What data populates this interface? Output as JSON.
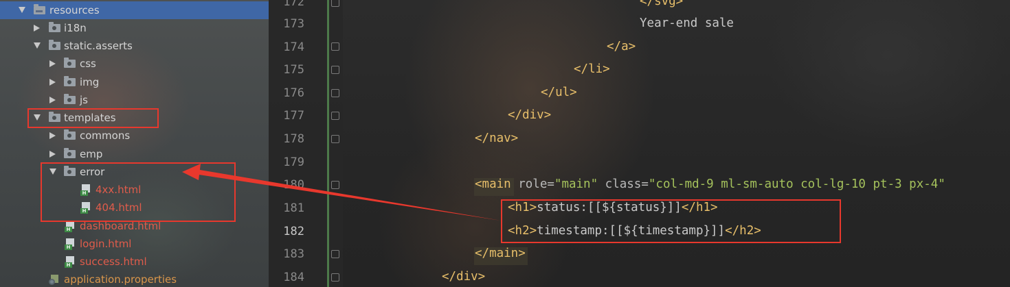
{
  "tree": {
    "items": [
      {
        "label": "resources",
        "level": 0,
        "kind": "res-folder",
        "state": "open",
        "selected": true
      },
      {
        "label": "i18n",
        "level": 1,
        "kind": "folder",
        "state": "closed"
      },
      {
        "label": "static.asserts",
        "level": 1,
        "kind": "folder",
        "state": "open"
      },
      {
        "label": "css",
        "level": 2,
        "kind": "folder",
        "state": "closed"
      },
      {
        "label": "img",
        "level": 2,
        "kind": "folder",
        "state": "closed"
      },
      {
        "label": "js",
        "level": 2,
        "kind": "folder",
        "state": "closed"
      },
      {
        "label": "templates",
        "level": 1,
        "kind": "folder",
        "state": "open"
      },
      {
        "label": "commons",
        "level": 2,
        "kind": "folder",
        "state": "closed"
      },
      {
        "label": "emp",
        "level": 2,
        "kind": "folder",
        "state": "closed"
      },
      {
        "label": "error",
        "level": 2,
        "kind": "folder",
        "state": "open"
      },
      {
        "label": "4xx.html",
        "level": 3,
        "kind": "html"
      },
      {
        "label": "404.html",
        "level": 3,
        "kind": "html"
      },
      {
        "label": "dashboard.html",
        "level": 2,
        "kind": "html"
      },
      {
        "label": "login.html",
        "level": 2,
        "kind": "html"
      },
      {
        "label": "success.html",
        "level": 2,
        "kind": "html"
      },
      {
        "label": "application.properties",
        "level": 1,
        "kind": "properties"
      }
    ]
  },
  "editor": {
    "current_line": 182,
    "lines": [
      {
        "num": "172",
        "text": "</svg>"
      },
      {
        "num": "173",
        "text": "Year-end sale"
      },
      {
        "num": "174",
        "text": "</a>"
      },
      {
        "num": "175",
        "text": "</li>"
      },
      {
        "num": "176",
        "text": "</ul>"
      },
      {
        "num": "177",
        "text": "</div>"
      },
      {
        "num": "178",
        "text": "</nav>"
      },
      {
        "num": "179",
        "text": ""
      },
      {
        "num": "180",
        "tag_open": "<main",
        "attr1": " role=",
        "val1": "\"main\"",
        "attr2": " class=",
        "val2": "\"col-md-9 ml-sm-auto col-lg-10 pt-3 px-4\""
      },
      {
        "num": "181",
        "tag_open": "<h1>",
        "content": "status:[[${status}]]",
        "tag_close": "</h1>"
      },
      {
        "num": "182",
        "tag_open": "<h2>",
        "content": "timestamp:[[${timestamp}]]",
        "tag_close": "</h2>"
      },
      {
        "num": "183",
        "text": "</main>"
      },
      {
        "num": "184",
        "text": "</div>"
      }
    ]
  },
  "colors": {
    "selection": "#3f67a6",
    "annotation_red": "#e8382d",
    "tag": "#e8bf6a",
    "string": "#a5c25c",
    "red_file": "#e05c4b"
  }
}
